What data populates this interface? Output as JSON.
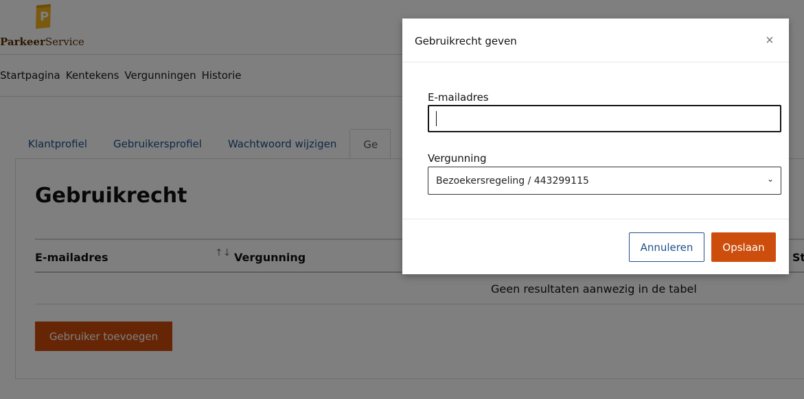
{
  "brand": {
    "name_bold": "Parkeer",
    "name_rest": "Service",
    "logo_letter": "P",
    "logo_color": "#f2b51c"
  },
  "nav": {
    "items": [
      "Startpagina",
      "Kentekens",
      "Vergunningen",
      "Historie"
    ]
  },
  "tabs": [
    {
      "label": "Klantprofiel"
    },
    {
      "label": "Gebruikersprofiel"
    },
    {
      "label": "Wachtwoord wijzigen"
    },
    {
      "label": "Ge"
    }
  ],
  "panel": {
    "title": "Gebruikrecht",
    "columns": [
      "E-mailadres",
      "Vergunning",
      "St"
    ],
    "sort_icon": "↑↓",
    "empty_text": "Geen resultaten aanwezig in de tabel",
    "add_button": "Gebruiker toevoegen"
  },
  "modal": {
    "title": "Gebruikrecht geven",
    "close_glyph": "×",
    "email_label": "E-mailadres",
    "email_value": "",
    "license_label": "Vergunning",
    "license_selected": "Bezoekersregeling / 443299115",
    "chevron_glyph": "⌄",
    "cancel_label": "Annuleren",
    "save_label": "Opslaan"
  },
  "colors": {
    "accent": "#cc4d0c",
    "link": "#1f4e8c"
  }
}
